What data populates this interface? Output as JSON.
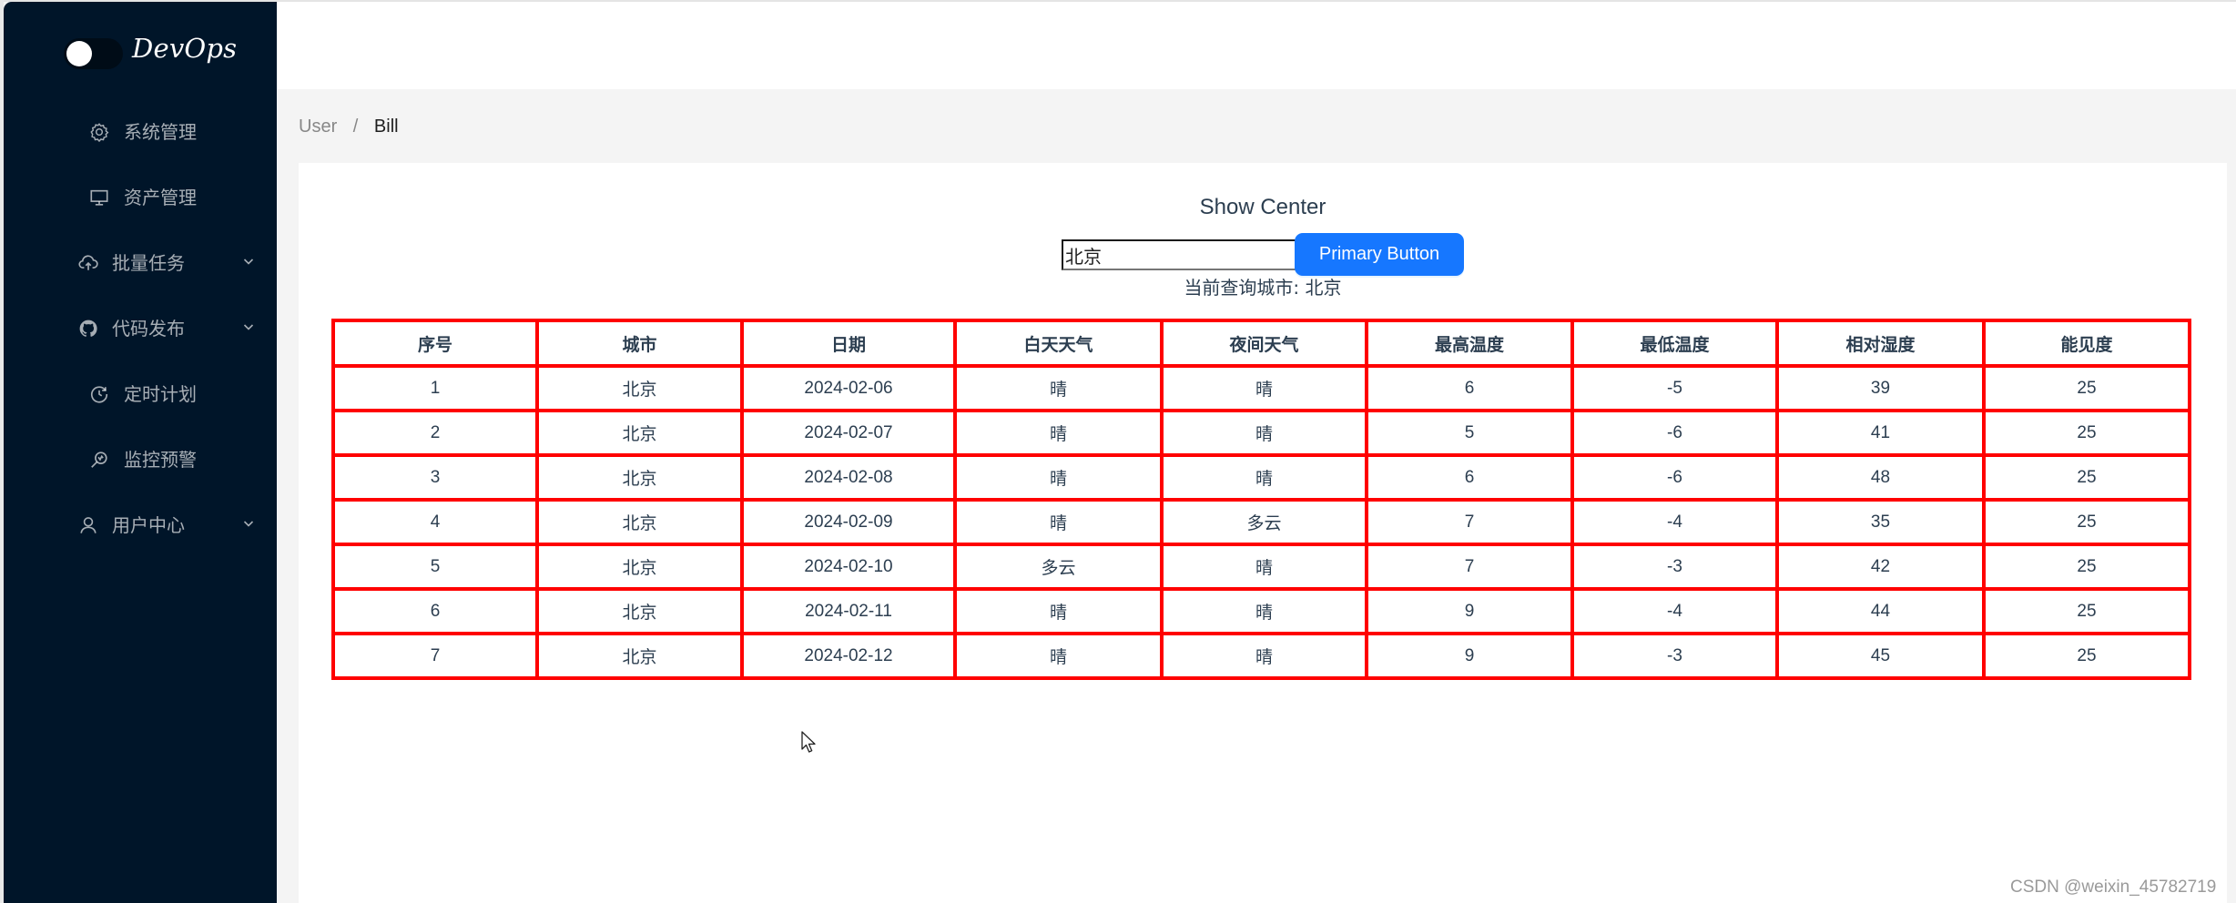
{
  "app": {
    "logo_text": "DevOps",
    "theme_toggle": "on"
  },
  "sidebar": {
    "items": [
      {
        "label": "系统管理",
        "icon": "gear-icon",
        "has_submenu": false
      },
      {
        "label": "资产管理",
        "icon": "desktop-icon",
        "has_submenu": false
      },
      {
        "label": "批量任务",
        "icon": "cloud-upload-icon",
        "has_submenu": true
      },
      {
        "label": "代码发布",
        "icon": "github-icon",
        "has_submenu": true
      },
      {
        "label": "定时计划",
        "icon": "clock-icon",
        "has_submenu": false
      },
      {
        "label": "监控预警",
        "icon": "monitor-search-icon",
        "has_submenu": false
      },
      {
        "label": "用户中心",
        "icon": "user-icon",
        "has_submenu": true
      }
    ]
  },
  "breadcrumb": {
    "items": [
      "User",
      "Bill"
    ],
    "separator": "/"
  },
  "main": {
    "title": "Show Center",
    "city_input": {
      "value": "北京",
      "placeholder": ""
    },
    "primary_button": "Primary Button",
    "current_city_text": "当前查询城市: 北京"
  },
  "table": {
    "columns": [
      "序号",
      "城市",
      "日期",
      "白天天气",
      "夜间天气",
      "最高温度",
      "最低温度",
      "相对湿度",
      "能见度"
    ],
    "rows": [
      [
        "1",
        "北京",
        "2024-02-06",
        "晴",
        "晴",
        "6",
        "-5",
        "39",
        "25"
      ],
      [
        "2",
        "北京",
        "2024-02-07",
        "晴",
        "晴",
        "5",
        "-6",
        "41",
        "25"
      ],
      [
        "3",
        "北京",
        "2024-02-08",
        "晴",
        "晴",
        "6",
        "-6",
        "48",
        "25"
      ],
      [
        "4",
        "北京",
        "2024-02-09",
        "晴",
        "多云",
        "7",
        "-4",
        "35",
        "25"
      ],
      [
        "5",
        "北京",
        "2024-02-10",
        "多云",
        "晴",
        "7",
        "-3",
        "42",
        "25"
      ],
      [
        "6",
        "北京",
        "2024-02-11",
        "晴",
        "晴",
        "9",
        "-4",
        "44",
        "25"
      ],
      [
        "7",
        "北京",
        "2024-02-12",
        "晴",
        "晴",
        "9",
        "-3",
        "45",
        "25"
      ]
    ]
  },
  "colors": {
    "sidebar_bg": "#001529",
    "primary": "#1677ff",
    "table_border": "#ff0000",
    "page_bg": "#f4f4f4"
  },
  "watermark": "CSDN @weixin_45782719"
}
